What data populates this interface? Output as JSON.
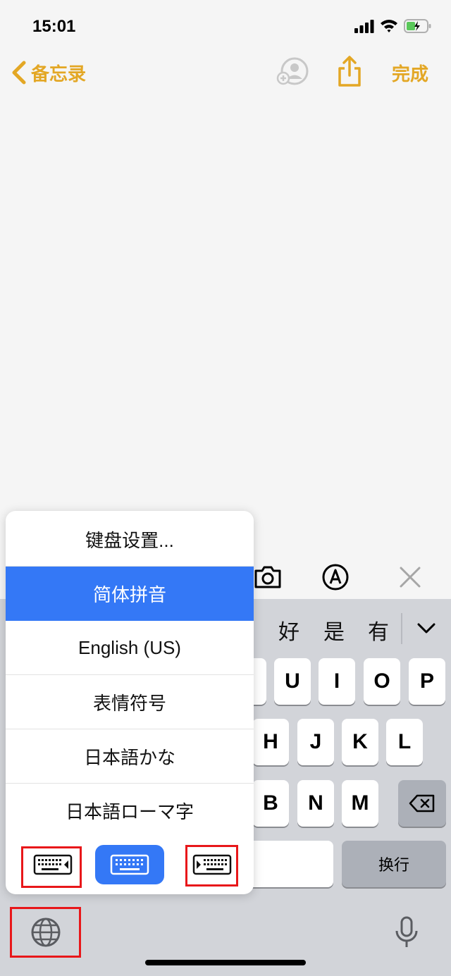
{
  "status": {
    "time": "15:01"
  },
  "nav": {
    "back_label": "备忘录",
    "done_label": "完成"
  },
  "candidates": [
    "好",
    "是",
    "有"
  ],
  "keys": {
    "row1": [
      "U",
      "I",
      "O",
      "P"
    ],
    "row2": [
      "H",
      "J",
      "K",
      "L"
    ],
    "row3": [
      "B",
      "N",
      "M"
    ],
    "return_label": "换行"
  },
  "menu": {
    "items": [
      "键盘设置...",
      "简体拼音",
      "English (US)",
      "表情符号",
      "日本語かな",
      "日本語ローマ字"
    ],
    "selected": "简体拼音"
  },
  "colors": {
    "accent": "#e3a725",
    "selection": "#3478f6",
    "highlight_box": "#e8171a",
    "keyboard_bg": "#d2d4d9"
  },
  "icons": [
    "signal-icon",
    "wifi-icon",
    "battery-charging-icon",
    "chevron-left-icon",
    "add-person-icon",
    "share-icon",
    "camera-icon",
    "markup-icon",
    "close-icon",
    "chevron-down-icon",
    "delete-icon",
    "globe-icon",
    "microphone-icon",
    "keyboard-left-icon",
    "keyboard-full-icon",
    "keyboard-right-icon"
  ]
}
